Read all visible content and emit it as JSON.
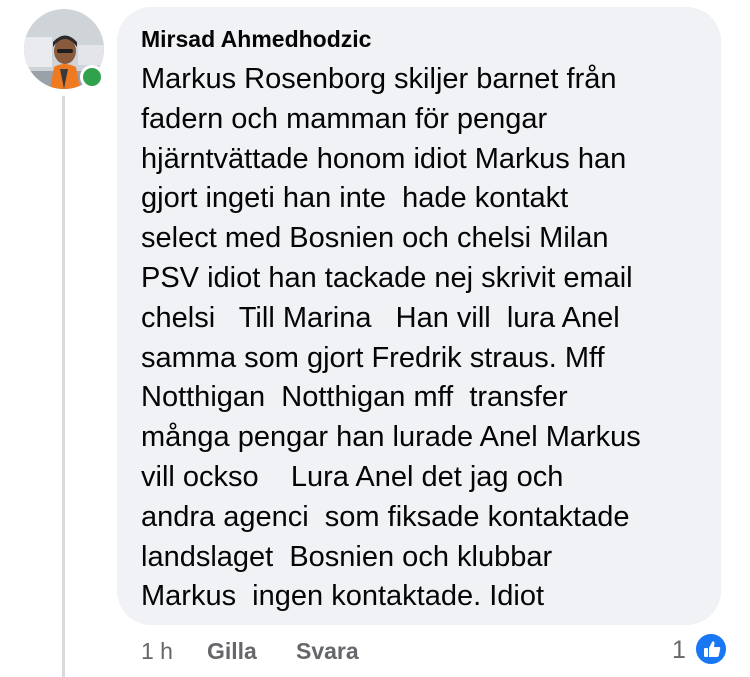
{
  "comment": {
    "author": "Mirsad Ahmedhodzic",
    "lines": [
      "Markus Rosenborg skiljer barnet från",
      "fadern och mamman för pengar",
      "hjärntvättade honom idiot Markus han",
      "gjort ingeti han inte  hade kontakt",
      "select med Bosnien och chelsi Milan",
      "PSV idiot han tackade nej skrivit email",
      "chelsi   Till Marina   Han vill  lura Anel",
      "samma som gjort Fredrik straus. Mff",
      "Notthigan  Notthigan mff  transfer",
      "många pengar han lurade Anel Markus",
      "vill ockso    Lura Anel det jag och",
      "andra agenci  som fiksade kontaktade",
      "landslaget  Bosnien och klubbar",
      "Markus  ingen kontaktade. Idiot"
    ]
  },
  "meta": {
    "time": "1 h",
    "like_label": "Gilla",
    "reply_label": "Svara"
  },
  "reactions": {
    "count": "1",
    "icon": "like-icon"
  },
  "colors": {
    "bubble": "#f0f2f5",
    "online": "#31a24c",
    "like": "#1877f2",
    "meta_text": "#65676b"
  }
}
